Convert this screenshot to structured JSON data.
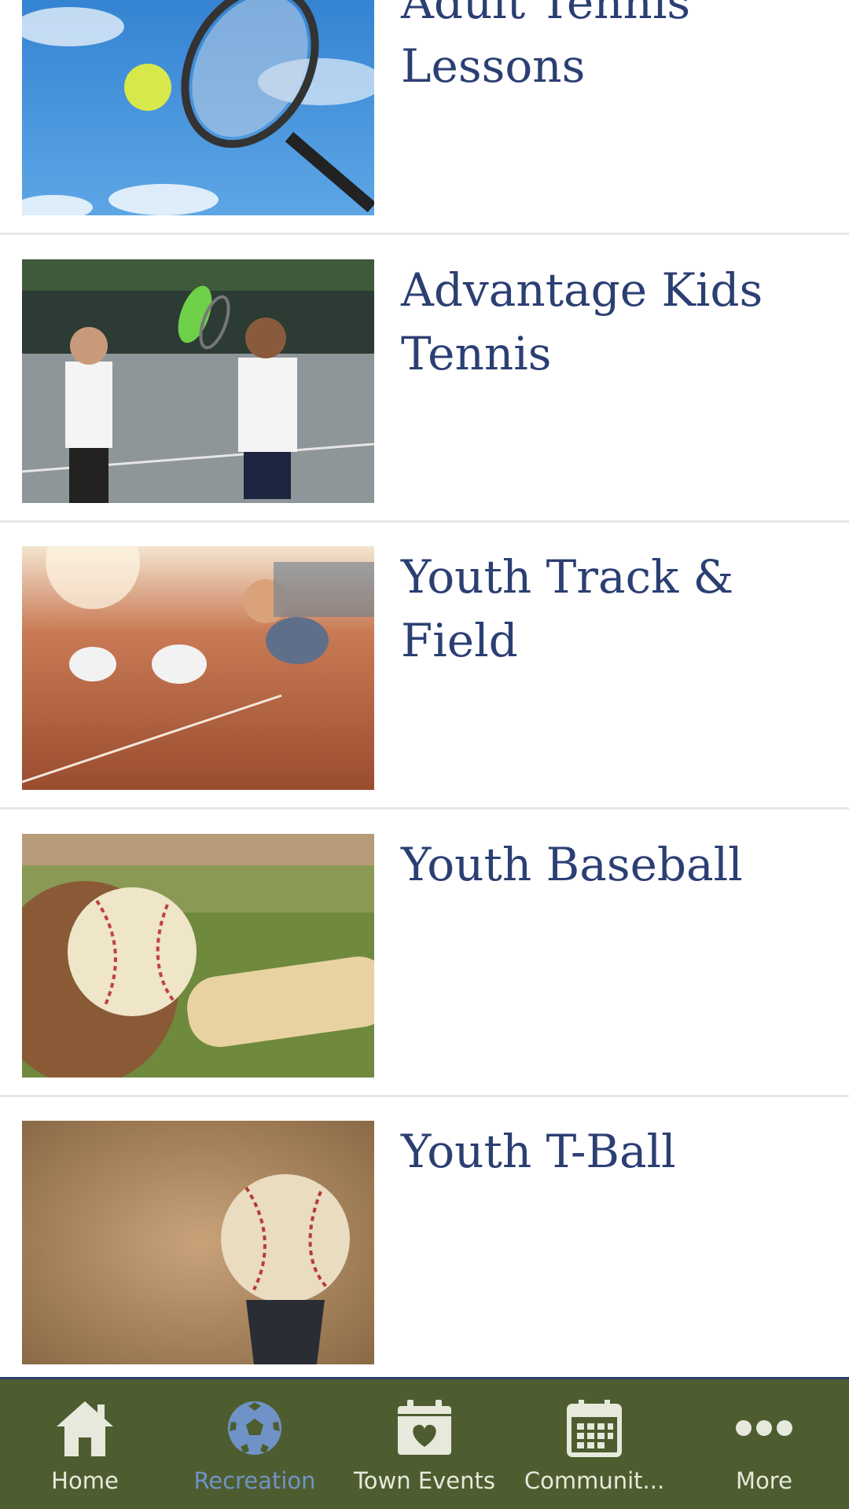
{
  "items": [
    {
      "title": "Adult Tennis Lessons"
    },
    {
      "title": "Advantage Kids Tennis"
    },
    {
      "title": "Youth Track & Field"
    },
    {
      "title": "Youth Baseball"
    },
    {
      "title": "Youth T-Ball"
    }
  ],
  "tabs": [
    {
      "label": "Home",
      "icon": "home-icon"
    },
    {
      "label": "Recreation",
      "icon": "soccer-ball-icon",
      "active": true
    },
    {
      "label": "Town Events",
      "icon": "calendar-heart-icon"
    },
    {
      "label": "Communit...",
      "icon": "calendar-grid-icon"
    },
    {
      "label": "More",
      "icon": "more-dots-icon"
    }
  ],
  "colors": {
    "title": "#2b3f73",
    "tabbar": "#4e5d2f",
    "active_tab": "#6f93c7",
    "tab_text": "#e7e9dd"
  }
}
